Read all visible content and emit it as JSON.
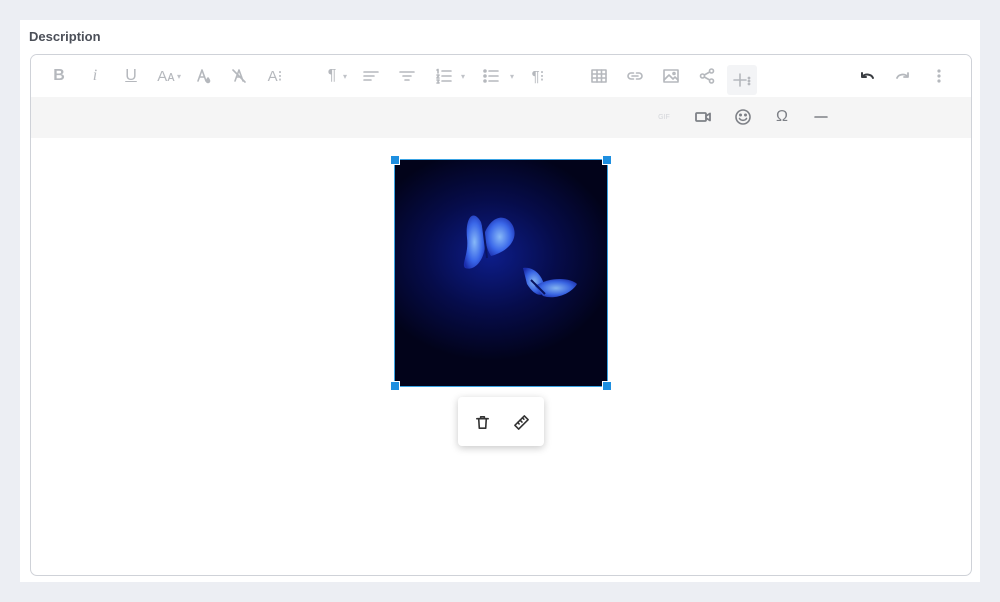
{
  "field": {
    "label": "Description"
  },
  "toolbar": {
    "bold": "B",
    "italic": "i",
    "underline": "U",
    "font_size": "Aᴀ",
    "character": "A⁝",
    "paragraph_mark": "¶",
    "paragraph_style": "¶⁝",
    "special_char": "Ω",
    "gif": "GIF"
  },
  "colors": {
    "selection": "#1e8fe0",
    "toolbar_icon": "#b5b8bd",
    "toolbar_active": "#3a3d42"
  },
  "image": {
    "description_icon": "butterfly-image"
  }
}
